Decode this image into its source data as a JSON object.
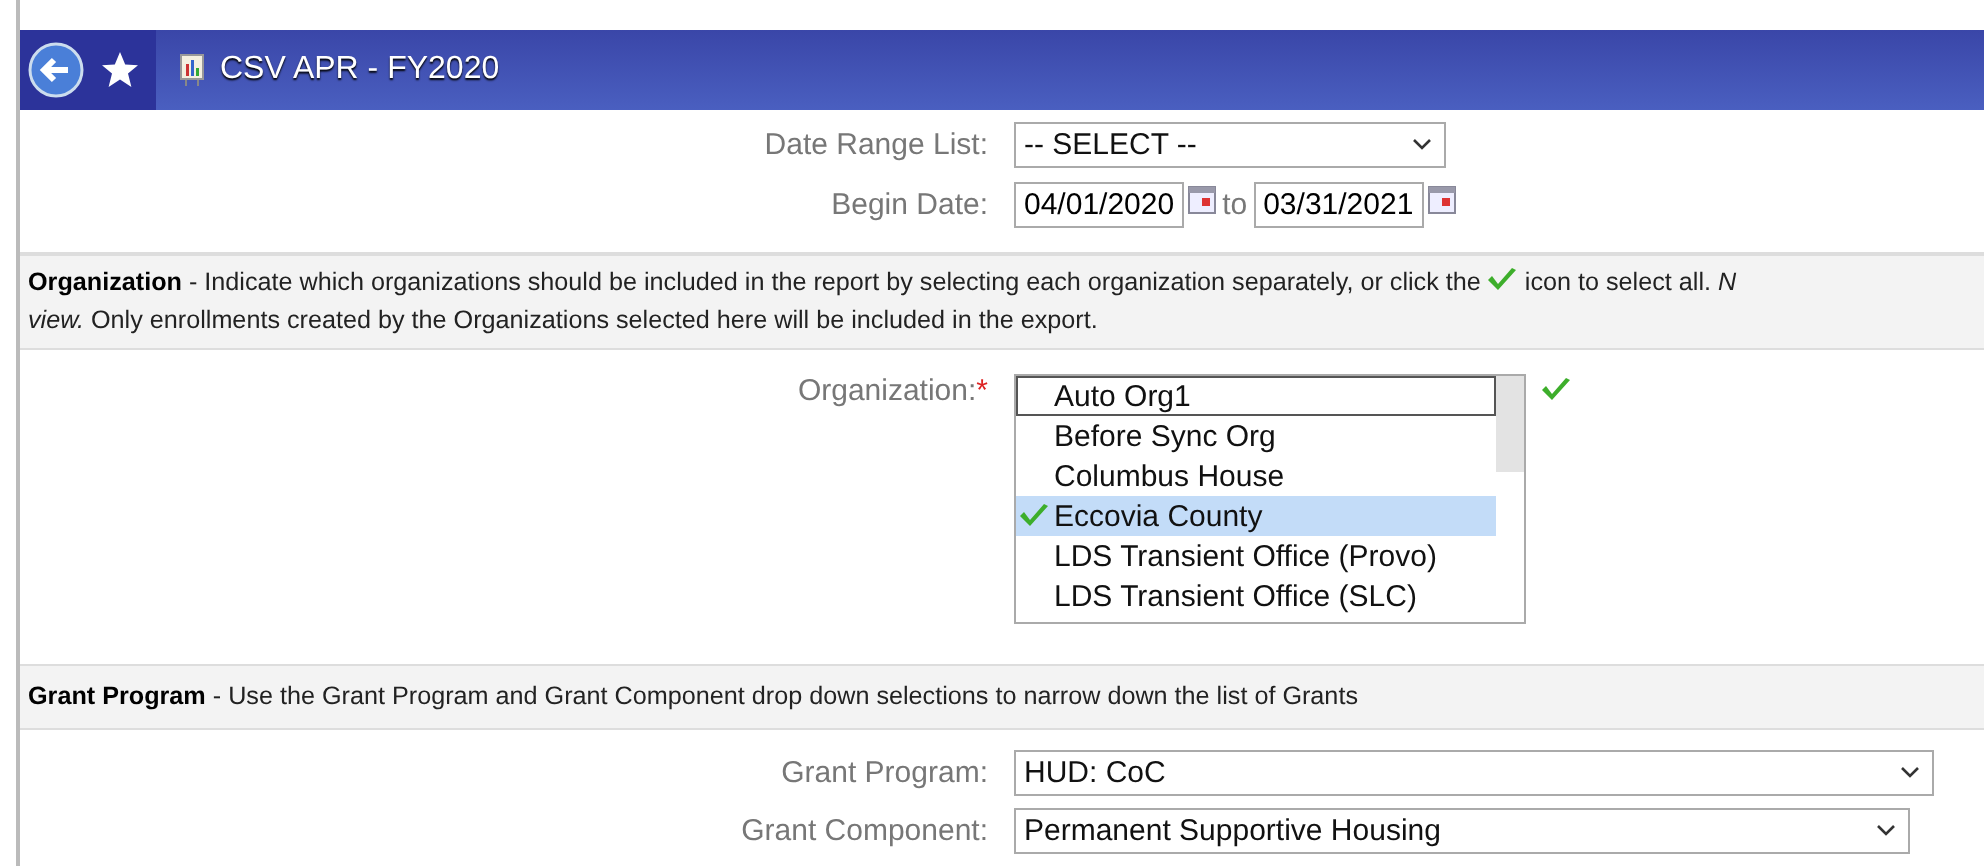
{
  "header": {
    "title": "CSV APR - FY2020"
  },
  "date_fields": {
    "range_label": "Date Range List:",
    "range_value": "-- SELECT --",
    "begin_label": "Begin Date:",
    "begin_value": "04/01/2020",
    "to_label": "to",
    "end_value": "03/31/2021"
  },
  "organization_section": {
    "line_1_before_icon": "**Organization** - Indicate which organizations should be included in the report by selecting each organization separately, or click the",
    "line_1_after_icon": "icon to select all. *N*",
    "line_2": "*view.* Only enrollments created by the Organizations selected here will be included in the export."
  },
  "organization_field": {
    "label": "Organization:",
    "required_mark": "*",
    "items": [
      {
        "name": "Auto Org1",
        "selected": false,
        "focused": true
      },
      {
        "name": "Before Sync Org",
        "selected": false,
        "focused": false
      },
      {
        "name": "Columbus House",
        "selected": false,
        "focused": false
      },
      {
        "name": "Eccovia County",
        "selected": true,
        "focused": false
      },
      {
        "name": "LDS Transient Office (Provo)",
        "selected": false,
        "focused": false
      },
      {
        "name": "LDS Transient Office (SLC)",
        "selected": false,
        "focused": false
      }
    ]
  },
  "grant_section": {
    "description": "**Grant Program** - Use the Grant Program and Grant Component drop down selections to narrow down the list of Grants"
  },
  "grant_fields": [
    {
      "label": "Grant Program:",
      "value": "HUD: CoC"
    },
    {
      "label": "Grant Component:",
      "value": "Permanent Supportive Housing"
    }
  ]
}
